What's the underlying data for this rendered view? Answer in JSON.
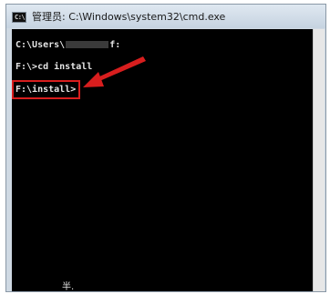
{
  "window": {
    "title": "管理员: C:\\Windows\\system32\\cmd.exe",
    "icon_label": "C:\\"
  },
  "console": {
    "line1_prefix": "C:\\Users\\",
    "line1_suffix": "f:",
    "line2": "F:\\>cd install",
    "line3": "F:\\install>",
    "bottom_mark": "半."
  },
  "colors": {
    "console_bg": "#000000",
    "console_text": "#e4e4e4",
    "annotation_red": "#d81e1e"
  },
  "icons": {
    "app_icon": "cmd-icon",
    "annotation_arrow": "red-arrow-icon"
  }
}
